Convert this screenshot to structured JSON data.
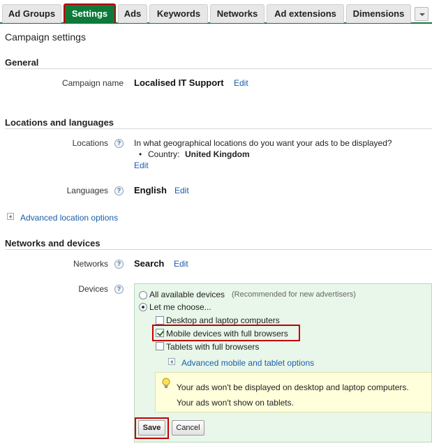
{
  "tabs": [
    {
      "label": "Ad Groups"
    },
    {
      "label": "Settings"
    },
    {
      "label": "Ads"
    },
    {
      "label": "Keywords"
    },
    {
      "label": "Networks"
    },
    {
      "label": "Ad extensions"
    },
    {
      "label": "Dimensions"
    }
  ],
  "page_title": "Campaign settings",
  "general": {
    "heading": "General",
    "campaign_name_label": "Campaign name",
    "campaign_name_value": "Localised IT Support",
    "edit": "Edit"
  },
  "locations": {
    "heading": "Locations and languages",
    "locations_label": "Locations",
    "question": "In what geographical locations do you want your ads to be displayed?",
    "country_prefix": "Country:",
    "country_value": "United Kingdom",
    "edit": "Edit",
    "languages_label": "Languages",
    "languages_value": "English",
    "languages_edit": "Edit",
    "advanced": "Advanced location options"
  },
  "networks": {
    "heading": "Networks and devices",
    "networks_label": "Networks",
    "networks_value": "Search",
    "networks_edit": "Edit",
    "devices_label": "Devices"
  },
  "devices": {
    "all_available": "All available devices",
    "all_available_note": "(Recommended for new advertisers)",
    "let_me_choose": "Let me choose...",
    "desktop": "Desktop and laptop computers",
    "mobile": "Mobile devices with full browsers",
    "tablets": "Tablets with full browsers",
    "advanced": "Advanced mobile and tablet options",
    "notice_line1": "Your ads won't be displayed on desktop and laptop computers.",
    "notice_line2": "Your ads won't show on tablets.",
    "save": "Save",
    "cancel": "Cancel"
  },
  "help_glyph": "?",
  "colors": {
    "active_tab": "#0e7a3a",
    "highlight": "#c00000",
    "link": "#1a5ea8",
    "devices_panel": "#e8f7ea",
    "notice": "#ffffdc"
  }
}
